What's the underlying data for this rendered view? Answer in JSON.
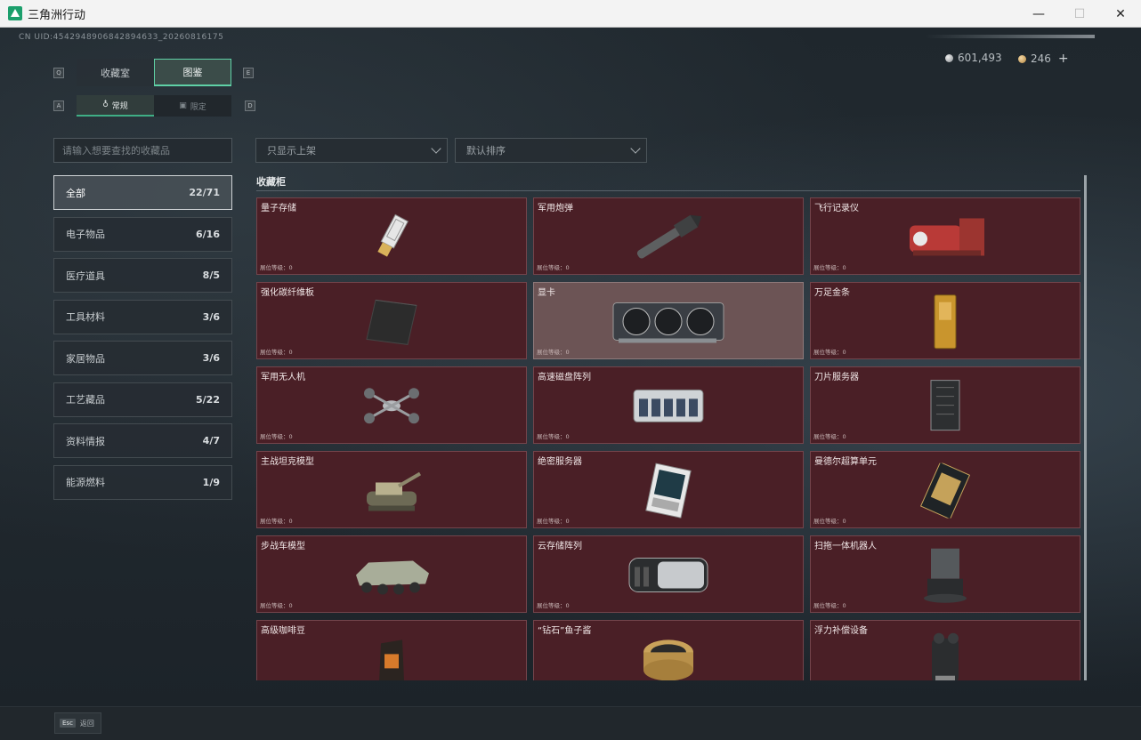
{
  "window": {
    "title": "三角洲行动",
    "minimize": "—",
    "maximize": "☐",
    "close": "✕"
  },
  "header": {
    "uid": "CN UID:4542948906842894633_20260816175",
    "currency_silver": "601,493",
    "currency_gold": "246",
    "plus": "+",
    "key_q": "Q",
    "key_e": "E",
    "key_a": "A",
    "key_d": "D"
  },
  "tabs": {
    "collection": "收藏室",
    "codex": "图鉴"
  },
  "subtabs": {
    "normal": "常规",
    "limited": "限定"
  },
  "filters": {
    "search_placeholder": "请输入想要查找的收藏品",
    "show_listed": "只显示上架",
    "sort": "默认排序"
  },
  "categories": [
    {
      "label": "全部",
      "count": "22/71"
    },
    {
      "label": "电子物品",
      "count": "6/16"
    },
    {
      "label": "医疗道具",
      "count": "8/5"
    },
    {
      "label": "工具材料",
      "count": "3/6"
    },
    {
      "label": "家居物品",
      "count": "3/6"
    },
    {
      "label": "工艺藏品",
      "count": "5/22"
    },
    {
      "label": "资料情报",
      "count": "4/7"
    },
    {
      "label": "能源燃料",
      "count": "1/9"
    }
  ],
  "section": {
    "title": "收藏柜"
  },
  "items": [
    {
      "name": "量子存储",
      "level": "展位等级：0",
      "icon": "usb-drive"
    },
    {
      "name": "军用炮弹",
      "level": "展位等级：0",
      "icon": "artillery-shell"
    },
    {
      "name": "飞行记录仪",
      "level": "展位等级：0",
      "icon": "flight-recorder"
    },
    {
      "name": "强化碳纤维板",
      "level": "展位等级：0",
      "icon": "carbon-plate"
    },
    {
      "name": "显卡",
      "level": "展位等级：0",
      "icon": "graphics-card"
    },
    {
      "name": "万足金条",
      "level": "展位等级：0",
      "icon": "gold-bar"
    },
    {
      "name": "军用无人机",
      "level": "展位等级：0",
      "icon": "drone"
    },
    {
      "name": "高速磁盘阵列",
      "level": "展位等级：0",
      "icon": "disk-array"
    },
    {
      "name": "刀片服务器",
      "level": "展位等级：0",
      "icon": "blade-server"
    },
    {
      "name": "主战坦克模型",
      "level": "展位等级：0",
      "icon": "tank-model"
    },
    {
      "name": "绝密服务器",
      "level": "展位等级：0",
      "icon": "secret-server"
    },
    {
      "name": "曼德尔超算单元",
      "level": "展位等级：0",
      "icon": "compute-unit"
    },
    {
      "name": "步战车模型",
      "level": "展位等级：0",
      "icon": "ifv-model"
    },
    {
      "name": "云存储阵列",
      "level": "展位等级：0",
      "icon": "cloud-storage"
    },
    {
      "name": "扫拖一体机器人",
      "level": "展位等级：0",
      "icon": "mop-robot"
    },
    {
      "name": "高级咖啡豆",
      "level": "",
      "icon": "coffee-beans"
    },
    {
      "name": "“钻石”鱼子酱",
      "level": "",
      "icon": "caviar"
    },
    {
      "name": "浮力补偿设备",
      "level": "",
      "icon": "buoyancy-device"
    }
  ],
  "footer": {
    "esc_key": "Esc",
    "back": "返回"
  }
}
